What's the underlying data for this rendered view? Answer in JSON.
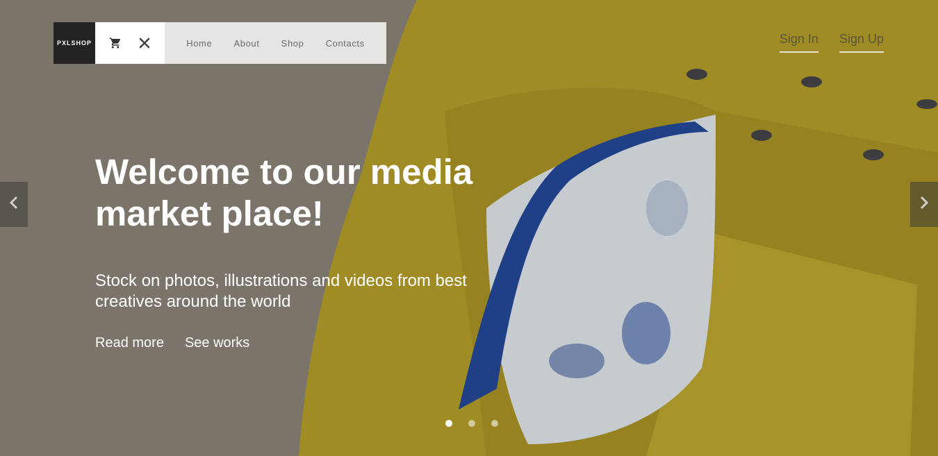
{
  "brand": {
    "logo_text": "PXLSHOP"
  },
  "header": {
    "icons": [
      "cart-icon",
      "close-icon"
    ],
    "nav": [
      {
        "label": "Home"
      },
      {
        "label": "About"
      },
      {
        "label": "Shop"
      },
      {
        "label": "Contacts"
      }
    ],
    "auth": {
      "sign_in": "Sign In",
      "sign_up": "Sign Up"
    }
  },
  "hero": {
    "headline": "Welcome to our media market place!",
    "subtitle": "Stock on photos, illustrations and videos from best creatives around the world",
    "links": {
      "read_more": "Read more",
      "see_works": "See works"
    },
    "slides": {
      "count": 3,
      "active": 1
    }
  },
  "carousel": {
    "prev_icon": "chevron-left-icon",
    "next_icon": "chevron-right-icon"
  },
  "colors": {
    "backdrop": "#8c8478",
    "chair_yellow": "#b9a22c",
    "pillow_blue": "#24489a",
    "logo_bg": "#232323",
    "menu_bg": "#e7e5e3"
  }
}
